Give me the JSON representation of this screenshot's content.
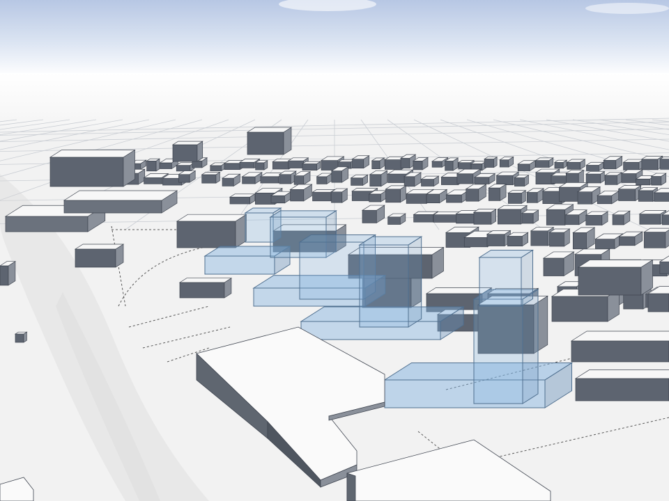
{
  "viewport": {
    "scene": "3d-city-massing",
    "colors": {
      "sky_top": "#b9c9e6",
      "sky_haze": "#ffffff",
      "ground": "#f4f4f4",
      "grid_line": "#cfd3d8",
      "building_roof": "#f7f7f7",
      "building_wall_dark": "#5d6470",
      "building_wall_mid": "#8a909a",
      "proposal_fill": "#7fb0de",
      "proposal_stroke": "#4f6f8f",
      "road_line": "#3a3a3a"
    },
    "context_building_icon": "box-icon",
    "proposal_volume_icon": "translucent-box-icon"
  }
}
